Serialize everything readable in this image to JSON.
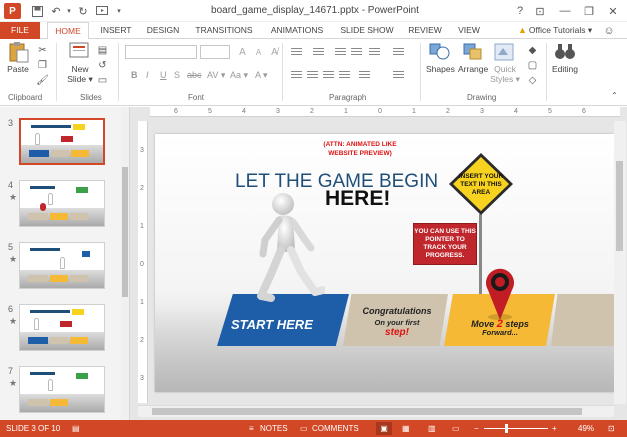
{
  "window": {
    "title": "board_game_display_14671.pptx - PowerPoint",
    "help": "?",
    "ribbon_opts": "⊡",
    "minimize": "—",
    "restore": "❐",
    "close": "✕"
  },
  "app_badge": "P",
  "tabs": [
    "FILE",
    "HOME",
    "INSERT",
    "DESIGN",
    "TRANSITIONS",
    "ANIMATIONS",
    "SLIDE SHOW",
    "REVIEW",
    "VIEW"
  ],
  "account": "Office Tutorials ▾",
  "ribbon": {
    "clipboard": {
      "paste": "Paste",
      "label": "Clipboard"
    },
    "slides": {
      "new_slide": "New Slide ▾",
      "label": "Slides"
    },
    "font": {
      "label": "Font",
      "buttons": [
        "B",
        "I",
        "U",
        "S",
        "abc",
        "AV ▾",
        "Aa ▾",
        "A ▾"
      ]
    },
    "paragraph": {
      "label": "Paragraph"
    },
    "drawing": {
      "shapes": "Shapes",
      "arrange": "Arrange",
      "quick_styles": "Quick Styles ▾",
      "label": "Drawing"
    },
    "editing": {
      "label": "Editing"
    }
  },
  "thumbnails": [
    {
      "num": "3",
      "star": "",
      "selected": true
    },
    {
      "num": "4",
      "star": "★",
      "selected": false
    },
    {
      "num": "5",
      "star": "★",
      "selected": false
    },
    {
      "num": "6",
      "star": "★",
      "selected": false
    },
    {
      "num": "7",
      "star": "★",
      "selected": false
    }
  ],
  "ruler": {
    "h": [
      "6",
      "5",
      "4",
      "3",
      "2",
      "1",
      "0",
      "1",
      "2",
      "3",
      "4",
      "5",
      "6"
    ],
    "v": [
      "3",
      "2",
      "1",
      "0",
      "1",
      "2",
      "3"
    ]
  },
  "slide": {
    "attn": "(ATTN: ANIMATED LIKE WEBSITE PREVIEW)",
    "title_line1": "LET THE GAME BEGIN",
    "title_line2": "HERE!",
    "sign_text": "INSERT YOUR TEXT IN THIS AREA",
    "callout": "YOU CAN USE THIS POINTER TO TRACK YOUR PROGRESS.",
    "start": "START HERE",
    "congrats_1": "Congratulations",
    "congrats_2": "On your first",
    "congrats_3": "step!",
    "move_1_a": "Move ",
    "move_num": "2",
    "move_1_b": " steps",
    "move_2": "Forward...",
    "colors": {
      "blue": "#1e5ea8",
      "yellow": "#f5b935",
      "red": "#c0272d",
      "beige": "#cfc3ad"
    }
  },
  "status": {
    "slide": "SLIDE 3 OF 10",
    "notes": "NOTES",
    "comments": "COMMENTS",
    "zoom": "49%",
    "minus": "−",
    "plus": "+"
  },
  "theme": {
    "accent": "#d24726",
    "title_blue": "#1f4e79"
  }
}
